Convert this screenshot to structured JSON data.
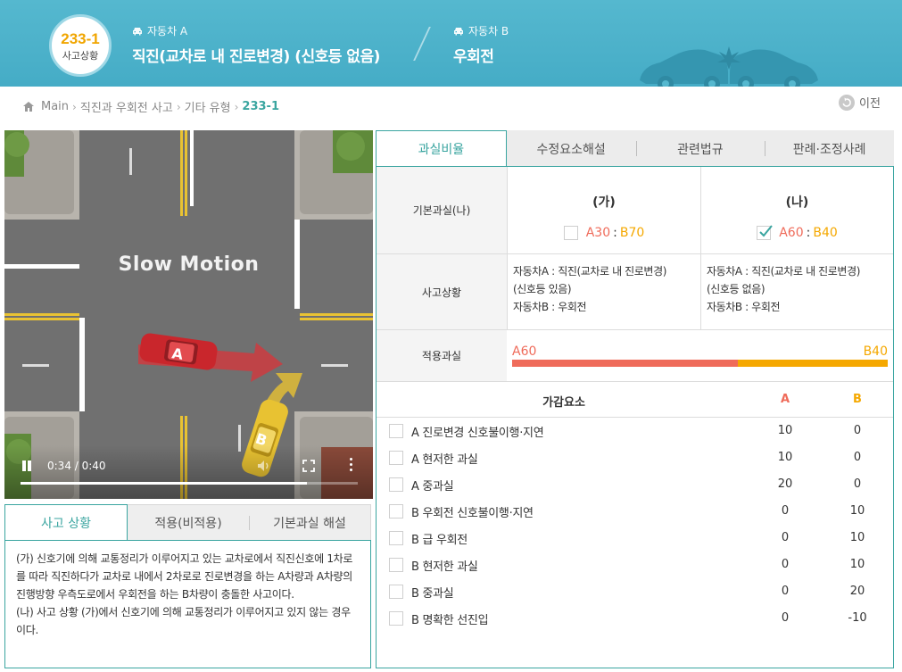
{
  "header": {
    "case_number": "233-1",
    "case_label": "사고상황",
    "vehicle_a": {
      "tag": "자동차 A",
      "description": "직진(교차로 내 진로변경) (신호등 없음)"
    },
    "vehicle_b": {
      "tag": "자동차 B",
      "description": "우회전"
    }
  },
  "breadcrumb": {
    "items": [
      "Main",
      "직진과 우회전 사고",
      "기타 유형"
    ],
    "current": "233-1"
  },
  "prev_button": {
    "label": "이전"
  },
  "video": {
    "overlay_text": "Slow Motion",
    "time_display": "0:34 / 0:40",
    "progress": 0.85,
    "car_a_label": "A",
    "car_b_label": "B"
  },
  "left_tabs": [
    "사고 상황",
    "적용(비적용)",
    "기본과실 해설"
  ],
  "left_panel": {
    "text_ga": "(가) 신호기에 의해 교통정리가 이루어지고 있는 교차로에서 직진신호에 1차로를 따라 직진하다가 교차로 내에서 2차로로 진로변경을 하는 A차량과 A차량의 진행방향 우측도로에서 우회전을 하는 B차량이 충돌한 사고이다.",
    "text_na": "(나) 사고 상황 (가)에서 신호기에 의해 교통정리가 이루어지고 있지 않는 경우이다."
  },
  "right_tabs": [
    "과실비율",
    "수정요소해설",
    "관련법규",
    "판례·조정사례"
  ],
  "basic_fault": {
    "label": "기본과실(나)",
    "option_ga": {
      "title": "(가)",
      "a": "A30",
      "b": "B70",
      "checked": false
    },
    "option_na": {
      "title": "(나)",
      "a": "A60",
      "b": "B40",
      "checked": true
    }
  },
  "situation": {
    "label": "사고상황",
    "ga": [
      "자동차A : 직진(교차로 내 진로변경)",
      "(신호등 있음)",
      "자동차B : 우회전"
    ],
    "na": [
      "자동차A : 직진(교차로 내 진로변경)",
      "(신호등 없음)",
      "자동차B : 우회전"
    ]
  },
  "applied_fault": {
    "label": "적용과실",
    "a_label": "A60",
    "b_label": "B40",
    "a_value": 60,
    "b_value": 40
  },
  "factors": {
    "header": "가감요소",
    "col_a": "A",
    "col_b": "B",
    "rows": [
      {
        "label": "A 진로변경 신호불이행·지연",
        "a": "10",
        "b": "0"
      },
      {
        "label": "A 현저한 과실",
        "a": "10",
        "b": "0"
      },
      {
        "label": "A 중과실",
        "a": "20",
        "b": "0"
      },
      {
        "label": "B 우회전 신호불이행·지연",
        "a": "0",
        "b": "10"
      },
      {
        "label": "B 급 우회전",
        "a": "0",
        "b": "10"
      },
      {
        "label": "B 현저한 과실",
        "a": "0",
        "b": "10"
      },
      {
        "label": "B 중과실",
        "a": "0",
        "b": "20"
      },
      {
        "label": "B 명확한 선진입",
        "a": "0",
        "b": "-10"
      }
    ]
  },
  "colors": {
    "header_bg": "#4fb3cb",
    "accent": "#3aa5a0",
    "a_color": "#ef6b5a",
    "b_color": "#f5a800"
  }
}
